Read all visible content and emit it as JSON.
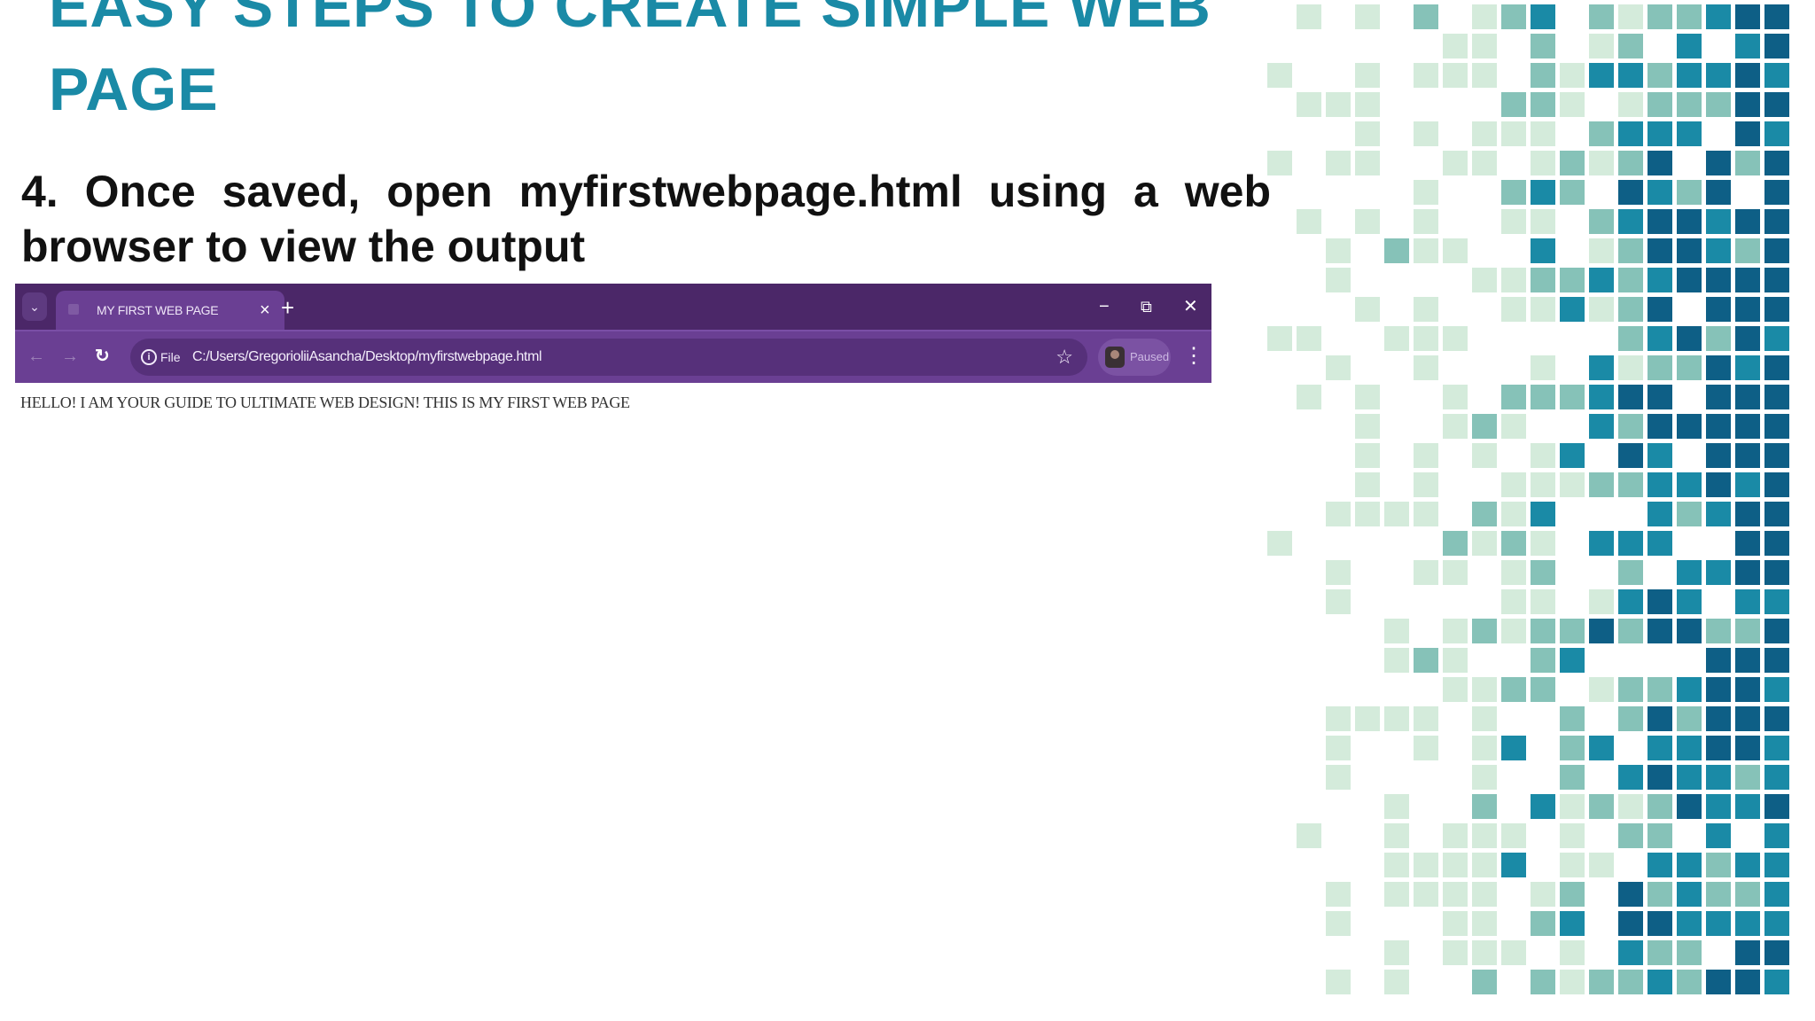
{
  "slide": {
    "title": "EASY STEPS TO CREATE SIMPLE WEB PAGE",
    "step_text": "4. Once saved, open myfirstwebpage.html using a web browser to view the output"
  },
  "browser": {
    "tab_title": "MY FIRST WEB PAGE",
    "tab_menu_icon": "⌄",
    "tab_close_icon": "×",
    "new_tab_icon": "+",
    "window_controls": {
      "minimize": "−",
      "restore": "⧉",
      "close": "✕"
    },
    "nav": {
      "back": "←",
      "forward": "→",
      "reload": "↻"
    },
    "address": {
      "scheme_label": "File",
      "url": "C:/Users/GregorioliiAsancha/Desktop/myfirstwebpage.html",
      "bookmark_icon": "☆"
    },
    "profile_label": "Paused",
    "menu_icon": "⋮",
    "page_text": "HELLO! I AM YOUR GUIDE TO ULTIMATE WEB DESIGN! THIS IS MY FIRST WEB PAGE"
  },
  "colors": {
    "title": "#1a8aa6",
    "tab_strip": "#4b2768",
    "toolbar": "#6a3f93",
    "mosaic_palette": [
      "#d4ebdb",
      "#86c2b8",
      "#1a8aa6",
      "#0e5f86"
    ]
  }
}
